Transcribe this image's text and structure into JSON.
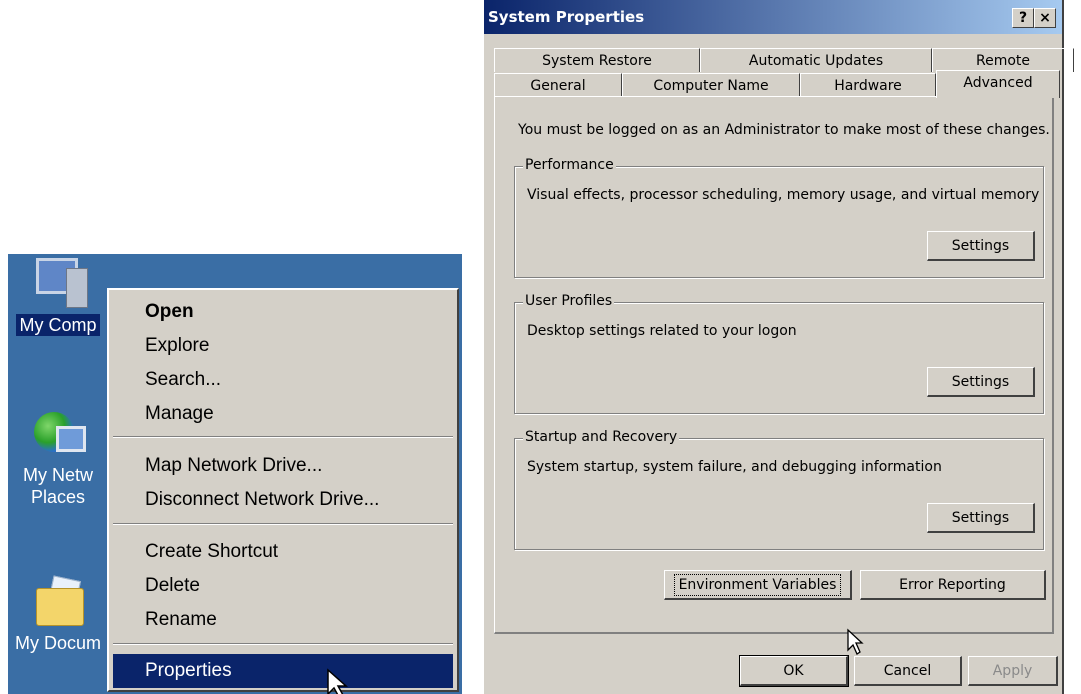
{
  "desktop": {
    "icons": [
      {
        "label_line1": "My Comp"
      },
      {
        "label_line1": "My Netw",
        "label_line2": "Places"
      },
      {
        "label_line1": "My Docum"
      }
    ]
  },
  "context_menu": {
    "items": [
      {
        "label": "Open"
      },
      {
        "label": "Explore"
      },
      {
        "label": "Search..."
      },
      {
        "label": "Manage"
      },
      {
        "label": "Map Network Drive..."
      },
      {
        "label": "Disconnect Network Drive..."
      },
      {
        "label": "Create Shortcut"
      },
      {
        "label": "Delete"
      },
      {
        "label": "Rename"
      },
      {
        "label": "Properties"
      }
    ]
  },
  "dialog": {
    "title": "System Properties",
    "help_btn": "?",
    "close_btn": "×",
    "tabs_row1": [
      "System Restore",
      "Automatic Updates",
      "Remote"
    ],
    "tabs_row2": [
      "General",
      "Computer Name",
      "Hardware",
      "Advanced"
    ],
    "active_tab": "Advanced",
    "note": "You must be logged on as an Administrator to make most of these changes.",
    "groups": [
      {
        "title": "Performance",
        "desc": "Visual effects, processor scheduling, memory usage, and virtual memory",
        "button": "Settings"
      },
      {
        "title": "User Profiles",
        "desc": "Desktop settings related to your logon",
        "button": "Settings"
      },
      {
        "title": "Startup and Recovery",
        "desc": "System startup, system failure, and debugging information",
        "button": "Settings"
      }
    ],
    "env_button": "Environment Variables",
    "error_button": "Error Reporting",
    "ok": "OK",
    "cancel": "Cancel",
    "apply": "Apply"
  },
  "colors": {
    "title_start": "#0a246a",
    "title_end": "#a6caf0",
    "face": "#d4d0c8",
    "desktop": "#3a6ea5",
    "highlight": "#0a246a"
  }
}
